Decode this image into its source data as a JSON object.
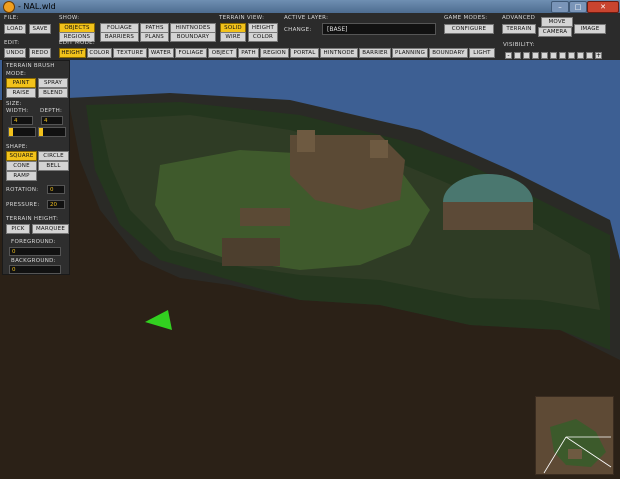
{
  "window": {
    "title": "- NAL.wld",
    "minimize": "–",
    "maximize": "□",
    "close": "✕"
  },
  "toolbar": {
    "file_label": "FILE:",
    "load": "LOAD",
    "save": "SAVE",
    "edit_label": "EDIT:",
    "undo": "UNDO",
    "redo": "REDO",
    "show_label": "SHOW:",
    "show_items": [
      "OBJECTS",
      "FOLIAGE",
      "PATHS",
      "HINTNODES",
      "REGIONS",
      "BARRIERS",
      "PLANS",
      "BOUNDARY"
    ],
    "terrain_view_label": "TERRAIN VIEW:",
    "terrain_view_items": [
      "SOLID",
      "HEIGHT",
      "WIRE",
      "COLOR"
    ],
    "active_layer_label": "ACTIVE LAYER:",
    "change_label": "CHANGE:",
    "active_layer_value": "[BASE]",
    "game_modes_label": "GAME MODES:",
    "configure": "CONFIGURE",
    "advanced_label": "ADVANCED",
    "advanced_items": [
      "TERRAIN",
      "MOVE",
      "CAMERA",
      "IMAGE"
    ],
    "edit_mode_label": "EDIT MODE:",
    "edit_mode_items": [
      "HEIGHT",
      "COLOR",
      "TEXTURE",
      "WATER",
      "FOLIAGE",
      "OBJECT",
      "PATH",
      "REGION",
      "PORTAL",
      "HINTNODE",
      "BARRIER",
      "PLANNING",
      "BOUNDARY",
      "LIGHT"
    ],
    "visibility_label": "VISIBILITY:",
    "visibility_minus": "-",
    "visibility_plus": "+",
    "visibility_level": 0
  },
  "brush": {
    "title": "TERRAIN BRUSH",
    "mode_label": "MODE:",
    "modes": [
      "PAINT",
      "SPRAY",
      "RAISE",
      "BLEND"
    ],
    "size_label": "SIZE:",
    "width_label": "WIDTH:",
    "depth_label": "DEPTH:",
    "width_value": "4",
    "depth_value": "4",
    "width_slider": 0.15,
    "depth_slider": 0.15,
    "shape_label": "SHAPE:",
    "shapes": [
      "SQUARE",
      "CIRCLE",
      "CONE",
      "BELL",
      "RAMP"
    ],
    "rotation_label": "ROTATION:",
    "rotation_value": "0",
    "pressure_label": "PRESSURE:",
    "pressure_value": "20",
    "terrain_height_label": "TERRAIN HEIGHT:",
    "pick": "PICK",
    "marquee": "MARQUEE",
    "foreground_label": "FOREGROUND:",
    "foreground_value": "0",
    "background_label": "BACKGROUND:",
    "background_value": "0"
  },
  "colors": {
    "accent": "#f2c21b",
    "sky": "#3d5f93",
    "ground": "#2b2117",
    "grass": "#3f5a2c"
  }
}
